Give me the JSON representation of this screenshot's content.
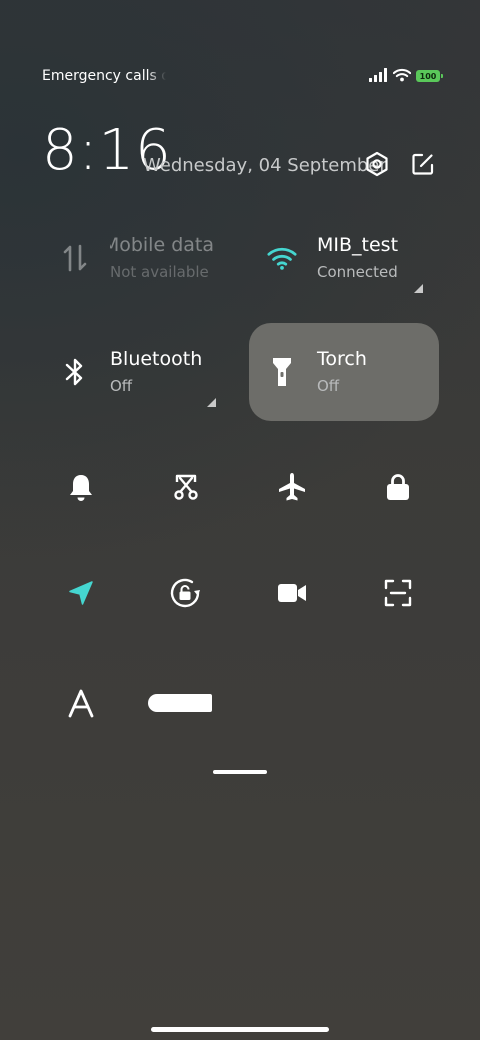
{
  "status_bar": {
    "carrier_text": "Emergency calls only",
    "battery": "100",
    "icons": [
      "signal-icon",
      "wifi-icon",
      "battery-icon"
    ]
  },
  "header": {
    "time": "8:16",
    "date": "Wednesday, 04 September",
    "icons": [
      "settings-icon",
      "edit-icon"
    ]
  },
  "tiles": [
    {
      "title": "Mobile data",
      "subtitle": "Not available",
      "icon": "mobile-data-icon",
      "state": "unavailable"
    },
    {
      "title": "MIB_test",
      "subtitle": "Connected",
      "icon": "wifi-icon",
      "state": "on"
    },
    {
      "title": "Bluetooth",
      "subtitle": "Off",
      "icon": "bluetooth-icon",
      "state": "off"
    },
    {
      "title": "Torch",
      "subtitle": "Off",
      "icon": "torch-icon",
      "state": "highlighted"
    }
  ],
  "toggles": [
    {
      "icon": "bell-icon"
    },
    {
      "icon": "screenshot-icon"
    },
    {
      "icon": "airplane-icon"
    },
    {
      "icon": "lock-icon"
    },
    {
      "icon": "location-icon",
      "state": "on"
    },
    {
      "icon": "rotation-lock-icon"
    },
    {
      "icon": "video-camera-icon"
    },
    {
      "icon": "scan-icon"
    }
  ],
  "brightness": {
    "icon": "auto-brightness-icon",
    "level": 0.3
  },
  "colors": {
    "accent": "#45d6d0",
    "text": "#ffffff",
    "subtext": "#b9bbbc",
    "tile_active": "#73736f",
    "battery": "#5ac85a"
  }
}
